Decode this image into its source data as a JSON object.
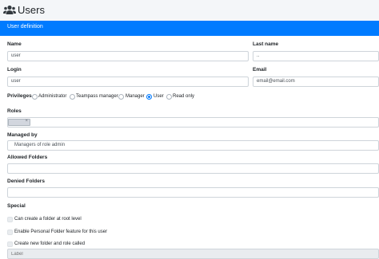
{
  "header": {
    "title": "Users"
  },
  "card": {
    "title": "User definition"
  },
  "form": {
    "name": {
      "label": "Name",
      "value": "user"
    },
    "lastname": {
      "label": "Last name",
      "value": ".."
    },
    "login": {
      "label": "Login",
      "value": "user"
    },
    "email": {
      "label": "Email",
      "value": "email@email.com"
    },
    "privileges": {
      "label": "Privileges",
      "options": [
        "Administrator",
        "Teampass manager",
        "Manager",
        "User",
        "Read only"
      ],
      "selected": "User"
    },
    "roles": {
      "label": "Roles"
    },
    "managed_by": {
      "label": "Managed by",
      "value": "Managers of role admin"
    },
    "allowed_folders": {
      "label": "Allowed Folders"
    },
    "denied_folders": {
      "label": "Denied Folders"
    },
    "special": {
      "label": "Special",
      "items": [
        "Can create a folder at root level",
        "Enable Personal Folder feature for this user",
        "Create new folder and role called"
      ],
      "folder_placeholder": "Label"
    }
  },
  "colors": {
    "accent": "#007bff",
    "background": "#f4f6f9"
  }
}
